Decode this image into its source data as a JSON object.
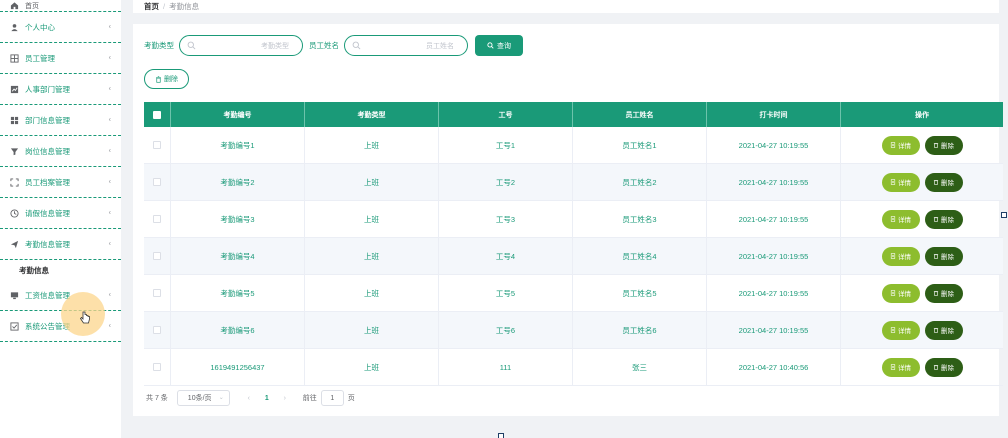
{
  "sidebar": {
    "home": "首页",
    "items": [
      {
        "label": "个人中心",
        "icon": "user-icon"
      },
      {
        "label": "员工管理",
        "icon": "grid-icon"
      },
      {
        "label": "人事部门管理",
        "icon": "chart-icon"
      },
      {
        "label": "部门信息管理",
        "icon": "table-icon"
      },
      {
        "label": "岗位信息管理",
        "icon": "filter-icon"
      },
      {
        "label": "员工档案管理",
        "icon": "fullscreen-icon"
      },
      {
        "label": "请假信息管理",
        "icon": "clock-icon"
      },
      {
        "label": "考勤信息管理",
        "icon": "send-icon"
      }
    ],
    "submenu": "考勤信息",
    "items_after": [
      {
        "label": "工资信息管理",
        "icon": "monitor-icon"
      },
      {
        "label": "系统公告管理",
        "icon": "check-square-icon"
      }
    ]
  },
  "breadcrumb": {
    "home": "首页",
    "separator": "/",
    "current": "考勤信息"
  },
  "search": {
    "type_label": "考勤类型",
    "type_placeholder": "考勤类型",
    "name_label": "员工姓名",
    "name_placeholder": "员工姓名",
    "button": "查询"
  },
  "toolbar": {
    "delete_label": "删除"
  },
  "table": {
    "headers": [
      "考勤编号",
      "考勤类型",
      "工号",
      "员工姓名",
      "打卡时间",
      "操作"
    ],
    "rows": [
      [
        "考勤编号1",
        "上班",
        "工号1",
        "员工姓名1",
        "2021-04-27 10:19:55"
      ],
      [
        "考勤编号2",
        "上班",
        "工号2",
        "员工姓名2",
        "2021-04-27 10:19:55"
      ],
      [
        "考勤编号3",
        "上班",
        "工号3",
        "员工姓名3",
        "2021-04-27 10:19:55"
      ],
      [
        "考勤编号4",
        "上班",
        "工号4",
        "员工姓名4",
        "2021-04-27 10:19:55"
      ],
      [
        "考勤编号5",
        "上班",
        "工号5",
        "员工姓名5",
        "2021-04-27 10:19:55"
      ],
      [
        "考勤编号6",
        "上班",
        "工号6",
        "员工姓名6",
        "2021-04-27 10:19:55"
      ],
      [
        "1619491256437",
        "上班",
        "111",
        "张三",
        "2021-04-27 10:40:56"
      ]
    ],
    "detail_label": "详情",
    "delete_label": "删除"
  },
  "pagination": {
    "total": "共 7 条",
    "page_size": "10条/页",
    "current_page": "1",
    "goto_label": "前往",
    "goto_value": "1",
    "page_suffix": "页"
  },
  "colors": {
    "accent": "#1a9a78",
    "detail": "#8dbd2e",
    "delete": "#2d5e16"
  }
}
